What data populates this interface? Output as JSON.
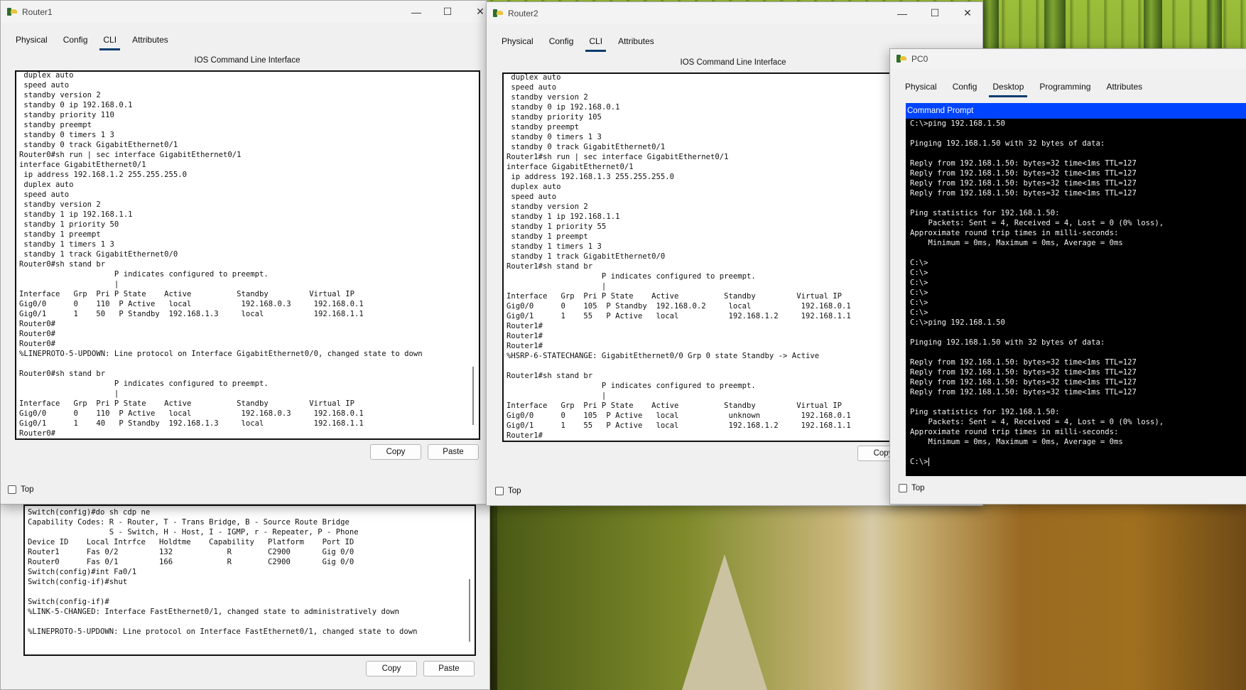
{
  "router1": {
    "title": "Router1",
    "tabs": [
      "Physical",
      "Config",
      "CLI",
      "Attributes"
    ],
    "active_tab": "CLI",
    "panel_title": "IOS Command Line Interface",
    "lines": [
      " duplex auto",
      " speed auto",
      " standby version 2",
      " standby 0 ip 192.168.0.1",
      " standby priority 110",
      " standby preempt",
      " standby 0 timers 1 3",
      " standby 0 track GigabitEthernet0/1",
      "Router0#sh run | sec interface GigabitEthernet0/1",
      "interface GigabitEthernet0/1",
      " ip address 192.168.1.2 255.255.255.0",
      " duplex auto",
      " speed auto",
      " standby version 2",
      " standby 1 ip 192.168.1.1",
      " standby 1 priority 50",
      " standby 1 preempt",
      " standby 1 timers 1 3",
      " standby 1 track GigabitEthernet0/0",
      "Router0#sh stand br",
      "                     P indicates configured to preempt.",
      "                     |",
      "Interface   Grp  Pri P State    Active          Standby         Virtual IP",
      "Gig0/0      0    110  P Active   local           192.168.0.3     192.168.0.1",
      "Gig0/1      1    50   P Standby  192.168.1.3     local           192.168.1.1",
      "Router0#",
      "Router0#",
      "Router0#",
      "%LINEPROTO-5-UPDOWN: Line protocol on Interface GigabitEthernet0/0, changed state to down",
      "",
      "Router0#sh stand br",
      "                     P indicates configured to preempt.",
      "                     |",
      "Interface   Grp  Pri P State    Active          Standby         Virtual IP",
      "Gig0/0      0    110  P Active   local           192.168.0.3     192.168.0.1",
      "Gig0/1      1    40   P Standby  192.168.1.3     local           192.168.1.1",
      "Router0#"
    ],
    "copy_label": "Copy",
    "paste_label": "Paste",
    "top_label": "Top"
  },
  "router2": {
    "title": "Router2",
    "tabs": [
      "Physical",
      "Config",
      "CLI",
      "Attributes"
    ],
    "active_tab": "CLI",
    "panel_title": "IOS Command Line Interface",
    "lines": [
      " duplex auto",
      " speed auto",
      " standby version 2",
      " standby 0 ip 192.168.0.1",
      " standby priority 105",
      " standby preempt",
      " standby 0 timers 1 3",
      " standby 0 track GigabitEthernet0/1",
      "Router1#sh run | sec interface GigabitEthernet0/1",
      "interface GigabitEthernet0/1",
      " ip address 192.168.1.3 255.255.255.0",
      " duplex auto",
      " speed auto",
      " standby version 2",
      " standby 1 ip 192.168.1.1",
      " standby 1 priority 55",
      " standby 1 preempt",
      " standby 1 timers 1 3",
      " standby 1 track GigabitEthernet0/0",
      "Router1#sh stand br",
      "                     P indicates configured to preempt.",
      "                     |",
      "Interface   Grp  Pri P State    Active          Standby         Virtual IP",
      "Gig0/0      0    105  P Standby  192.168.0.2     local           192.168.0.1",
      "Gig0/1      1    55   P Active   local           192.168.1.2     192.168.1.1",
      "Router1#",
      "Router1#",
      "Router1#",
      "%HSRP-6-STATECHANGE: GigabitEthernet0/0 Grp 0 state Standby -> Active",
      "",
      "Router1#sh stand br",
      "                     P indicates configured to preempt.",
      "                     |",
      "Interface   Grp  Pri P State    Active          Standby         Virtual IP",
      "Gig0/0      0    105  P Active   local           unknown         192.168.0.1",
      "Gig0/1      1    55   P Active   local           192.168.1.2     192.168.1.1",
      "Router1#"
    ],
    "copy_label": "Copy",
    "top_label": "Top"
  },
  "pc0": {
    "title": "PC0",
    "tabs": [
      "Physical",
      "Config",
      "Desktop",
      "Programming",
      "Attributes"
    ],
    "active_tab": "Desktop",
    "cmd_title": "Command Prompt",
    "lines": [
      "C:\\>ping 192.168.1.50",
      "",
      "Pinging 192.168.1.50 with 32 bytes of data:",
      "",
      "Reply from 192.168.1.50: bytes=32 time<1ms TTL=127",
      "Reply from 192.168.1.50: bytes=32 time<1ms TTL=127",
      "Reply from 192.168.1.50: bytes=32 time<1ms TTL=127",
      "Reply from 192.168.1.50: bytes=32 time<1ms TTL=127",
      "",
      "Ping statistics for 192.168.1.50:",
      "    Packets: Sent = 4, Received = 4, Lost = 0 (0% loss),",
      "Approximate round trip times in milli-seconds:",
      "    Minimum = 0ms, Maximum = 0ms, Average = 0ms",
      "",
      "C:\\>",
      "C:\\>",
      "C:\\>",
      "C:\\>",
      "C:\\>",
      "C:\\>",
      "C:\\>ping 192.168.1.50",
      "",
      "Pinging 192.168.1.50 with 32 bytes of data:",
      "",
      "Reply from 192.168.1.50: bytes=32 time<1ms TTL=127",
      "Reply from 192.168.1.50: bytes=32 time<1ms TTL=127",
      "Reply from 192.168.1.50: bytes=32 time<1ms TTL=127",
      "Reply from 192.168.1.50: bytes=32 time<1ms TTL=127",
      "",
      "Ping statistics for 192.168.1.50:",
      "    Packets: Sent = 4, Received = 4, Lost = 0 (0% loss),",
      "Approximate round trip times in milli-seconds:",
      "    Minimum = 0ms, Maximum = 0ms, Average = 0ms",
      "",
      "C:\\>"
    ],
    "top_label": "Top"
  },
  "switch": {
    "lines": [
      "Switch(config)#do sh cdp ne",
      "Capability Codes: R - Router, T - Trans Bridge, B - Source Route Bridge",
      "                  S - Switch, H - Host, I - IGMP, r - Repeater, P - Phone",
      "Device ID    Local Intrfce   Holdtme    Capability   Platform    Port ID",
      "Router1      Fas 0/2         132            R        C2900       Gig 0/0",
      "Router0      Fas 0/1         166            R        C2900       Gig 0/0",
      "Switch(config)#int Fa0/1",
      "Switch(config-if)#shut",
      "",
      "Switch(config-if)#",
      "%LINK-5-CHANGED: Interface FastEthernet0/1, changed state to administratively down",
      "",
      "%LINEPROTO-5-UPDOWN: Line protocol on Interface FastEthernet0/1, changed state to down"
    ],
    "copy_label": "Copy",
    "paste_label": "Paste"
  },
  "colors": {
    "cmd_header": "#0044ff",
    "active_tab_underline": "#0a3d6e",
    "cmd_background": "#000000"
  },
  "icons": [
    "packet-tracer-app-icon",
    "minimize-icon",
    "maximize-icon",
    "close-icon",
    "checkbox-icon"
  ]
}
